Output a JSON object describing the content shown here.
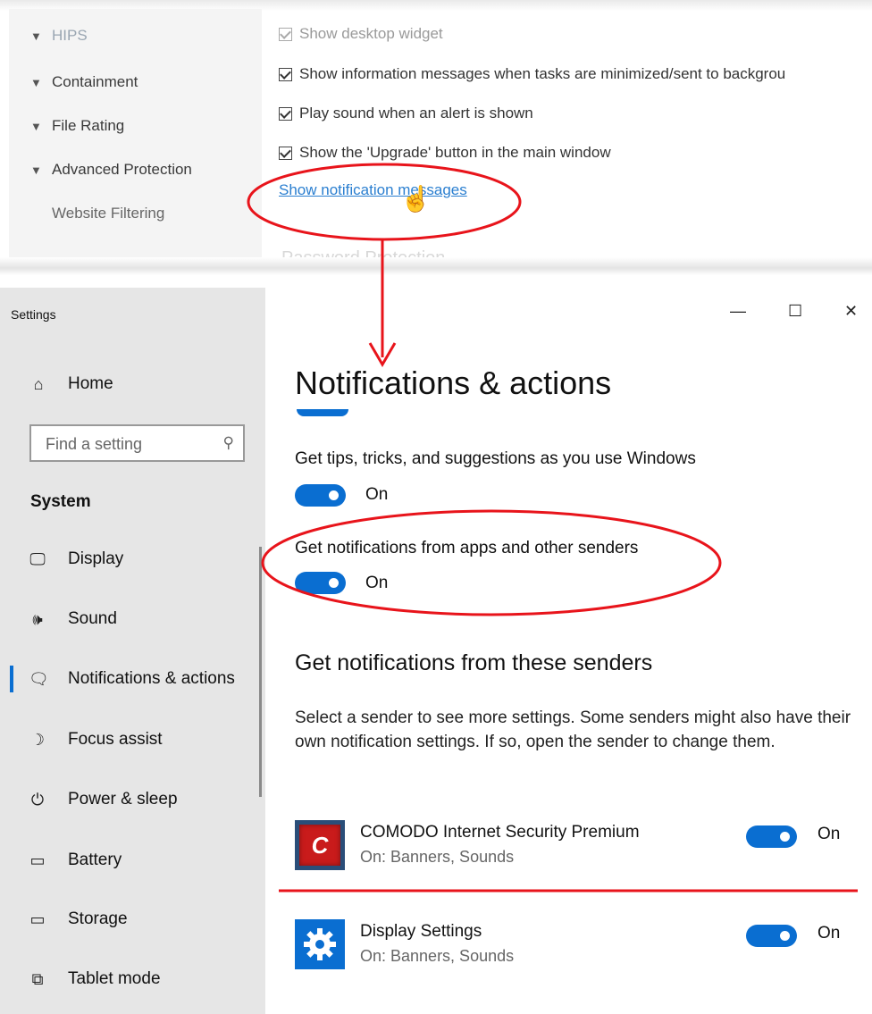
{
  "comodo": {
    "sidebar": [
      {
        "label": "HIPS",
        "faded": true
      },
      {
        "label": "Containment"
      },
      {
        "label": "File Rating"
      },
      {
        "label": "Advanced Protection"
      }
    ],
    "sidebar_sub": "Website Filtering",
    "checkboxes": [
      {
        "label": "Show desktop widget",
        "checked": true,
        "faded": true
      },
      {
        "label": "Show information messages when tasks are minimized/sent to backgrou",
        "checked": true
      },
      {
        "label": "Play sound when an alert is shown",
        "checked": true
      },
      {
        "label": "Show the 'Upgrade' button in the main window",
        "checked": true
      }
    ],
    "link": "Show notification messages",
    "faded_heading": "Password Protection"
  },
  "window": {
    "title": "Settings",
    "controls": {
      "minimize": "—",
      "maximize": "☐",
      "close": "✕"
    }
  },
  "sidebar": {
    "home": "Home",
    "search_placeholder": "Find a setting",
    "section": "System",
    "items": [
      {
        "label": "Display",
        "icon": "monitor-icon"
      },
      {
        "label": "Sound",
        "icon": "speaker-icon"
      },
      {
        "label": "Notifications & actions",
        "icon": "notification-icon",
        "selected": true
      },
      {
        "label": "Focus assist",
        "icon": "moon-icon"
      },
      {
        "label": "Power & sleep",
        "icon": "power-icon"
      },
      {
        "label": "Battery",
        "icon": "battery-icon"
      },
      {
        "label": "Storage",
        "icon": "storage-icon"
      },
      {
        "label": "Tablet mode",
        "icon": "tablet-icon"
      }
    ]
  },
  "main": {
    "title": "Notifications & actions",
    "settings": [
      {
        "label": "Get tips, tricks, and suggestions as you use Windows",
        "state": "On"
      },
      {
        "label": "Get notifications from apps and other senders",
        "state": "On"
      }
    ],
    "senders_title": "Get notifications from these senders",
    "senders_desc": "Select a sender to see more settings. Some senders might also have their own notification settings. If so, open the sender to change them.",
    "senders": [
      {
        "name": "COMODO Internet Security Premium",
        "sub": "On: Banners, Sounds",
        "state": "On",
        "icon": "comodo-icon",
        "icon_letter": "C"
      },
      {
        "name": "Display Settings",
        "sub": "On: Banners, Sounds",
        "state": "On",
        "icon": "gear-icon"
      }
    ]
  },
  "colors": {
    "accent": "#0a6ed1",
    "annotation": "#e8141b",
    "link": "#2b7fd0"
  }
}
